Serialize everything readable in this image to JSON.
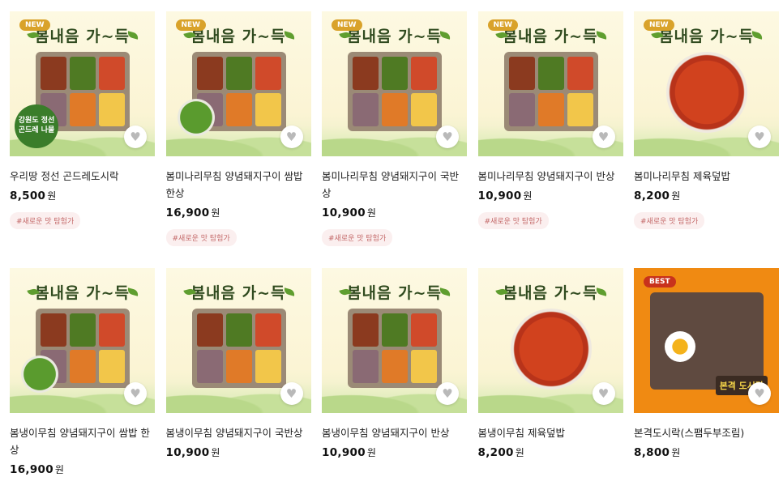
{
  "banner_text": "봄내음 가~득",
  "heart_icon": "heart-icon",
  "currency": "원",
  "products": [
    {
      "badge": "NEW",
      "name": "우리땅 정선 곤드레도시락",
      "price": "8,500",
      "tag": "#새로운 맛 탐험가",
      "logo_text": "강원도 정선 곤드레 나물",
      "image": "tray"
    },
    {
      "badge": "NEW",
      "name": "봄미나리무침 양념돼지구이 쌈밥 한상",
      "price": "16,900",
      "tag": "#새로운 맛 탐험가",
      "image": "tray-greens"
    },
    {
      "badge": "NEW",
      "name": "봄미나리무침 양념돼지구이 국반상",
      "price": "10,900",
      "tag": "#새로운 맛 탐험가",
      "image": "tray"
    },
    {
      "badge": "NEW",
      "name": "봄미나리무침 양념돼지구이 반상",
      "price": "10,900",
      "tag": "#새로운 맛 탐험가",
      "image": "tray"
    },
    {
      "badge": "NEW",
      "name": "봄미나리무침 제육덮밥",
      "price": "8,200",
      "tag": "#새로운 맛 탐험가",
      "image": "bowl"
    },
    {
      "badge": "",
      "name": "봄냉이무침 양념돼지구이 쌈밥 한상",
      "price": "16,900",
      "tag": "",
      "image": "tray-greens"
    },
    {
      "badge": "",
      "name": "봄냉이무침 양념돼지구이 국반상",
      "price": "10,900",
      "tag": "",
      "image": "tray"
    },
    {
      "badge": "",
      "name": "봄냉이무침 양념돼지구이 반상",
      "price": "10,900",
      "tag": "",
      "image": "tray"
    },
    {
      "badge": "",
      "name": "봄냉이무침 제육덮밥",
      "price": "8,200",
      "tag": "",
      "image": "bowl"
    },
    {
      "badge": "BEST",
      "name": "본격도시락(스팸두부조림)",
      "price": "8,800",
      "tag": "",
      "best_label": "본격 도시락",
      "image": "best"
    }
  ]
}
